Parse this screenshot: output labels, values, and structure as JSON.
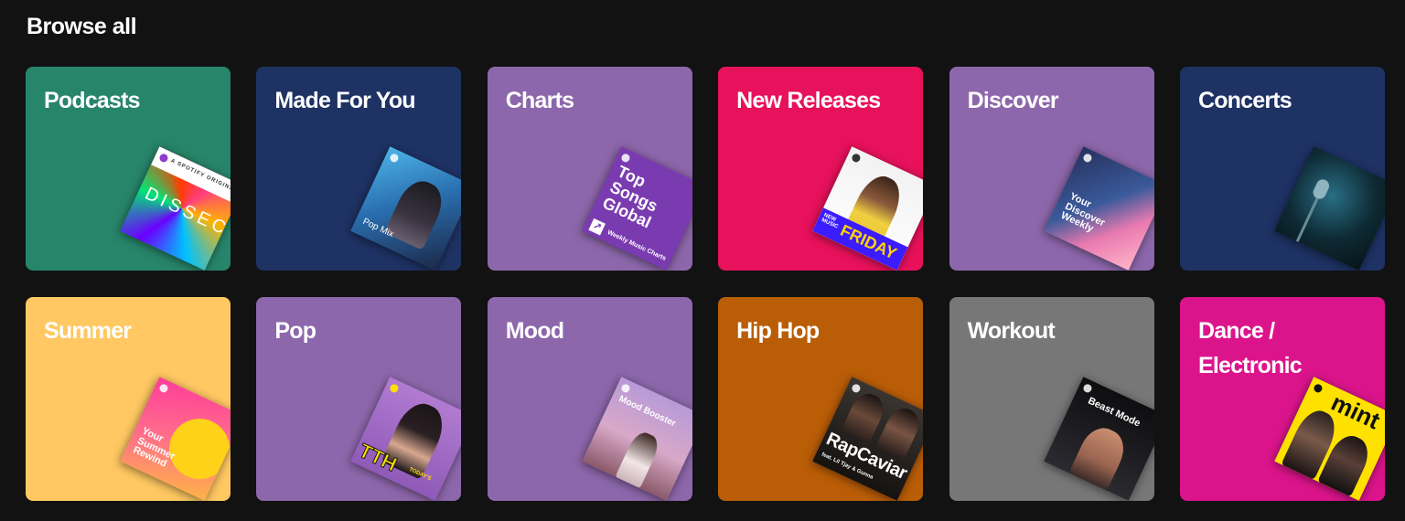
{
  "browse": {
    "title": "Browse all",
    "tiles": [
      {
        "label": "Podcasts",
        "color": "#27856a",
        "art": {
          "text": "DISSECT",
          "top_text": "A SPOTIFY ORIGINAL"
        }
      },
      {
        "label": "Made For You",
        "color": "#1e3264",
        "art": {
          "text": "Pop Mix"
        }
      },
      {
        "label": "Charts",
        "color": "#8d67ab",
        "art": {
          "text": "Top\nSongs\nGlobal",
          "sub": "Weekly Music Charts"
        }
      },
      {
        "label": "New Releases",
        "color": "#e8115b",
        "art": {
          "text": "FRIDAY",
          "sub": "NEW MUSIC"
        }
      },
      {
        "label": "Discover",
        "color": "#8d67ab",
        "art": {
          "text": "Your\nDiscover\nWeekly"
        }
      },
      {
        "label": "Concerts",
        "color": "#1e3264",
        "art": {}
      },
      {
        "label": "Summer",
        "color": "#ffc862",
        "art": {
          "text": "Your\nSummer\nRewind"
        }
      },
      {
        "label": "Pop",
        "color": "#8d67ab",
        "art": {
          "text": "TTH",
          "sub": "TODAY'S"
        }
      },
      {
        "label": "Mood",
        "color": "#8d67ab",
        "art": {
          "text": "Mood Booster"
        }
      },
      {
        "label": "Hip Hop",
        "color": "#ba5d07",
        "art": {
          "text": "RapCaviar",
          "sub": "feat. Lil Tjay & Gunna"
        }
      },
      {
        "label": "Workout",
        "color": "#777777",
        "art": {
          "text": "Beast Mode"
        }
      },
      {
        "label": "Dance /\nElectronic",
        "color": "#dc148c",
        "art": {
          "text": "mint"
        }
      }
    ]
  }
}
